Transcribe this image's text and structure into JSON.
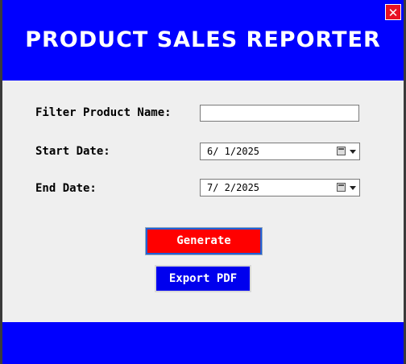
{
  "window": {
    "title": "PRODUCT SALES REPORTER",
    "close_symbol": "✕"
  },
  "form": {
    "product_name_label": "Filter Product Name:",
    "product_name_value": "",
    "start_date_label": "Start Date:",
    "start_date_value": "6/ 1/2025",
    "end_date_label": "End Date:",
    "end_date_value": "7/ 2/2025"
  },
  "actions": {
    "generate_label": "Generate",
    "export_label": "Export PDF"
  },
  "colors": {
    "header_bg": "#0000ff",
    "generate_bg": "#ff0000",
    "export_bg": "#0000ee"
  }
}
